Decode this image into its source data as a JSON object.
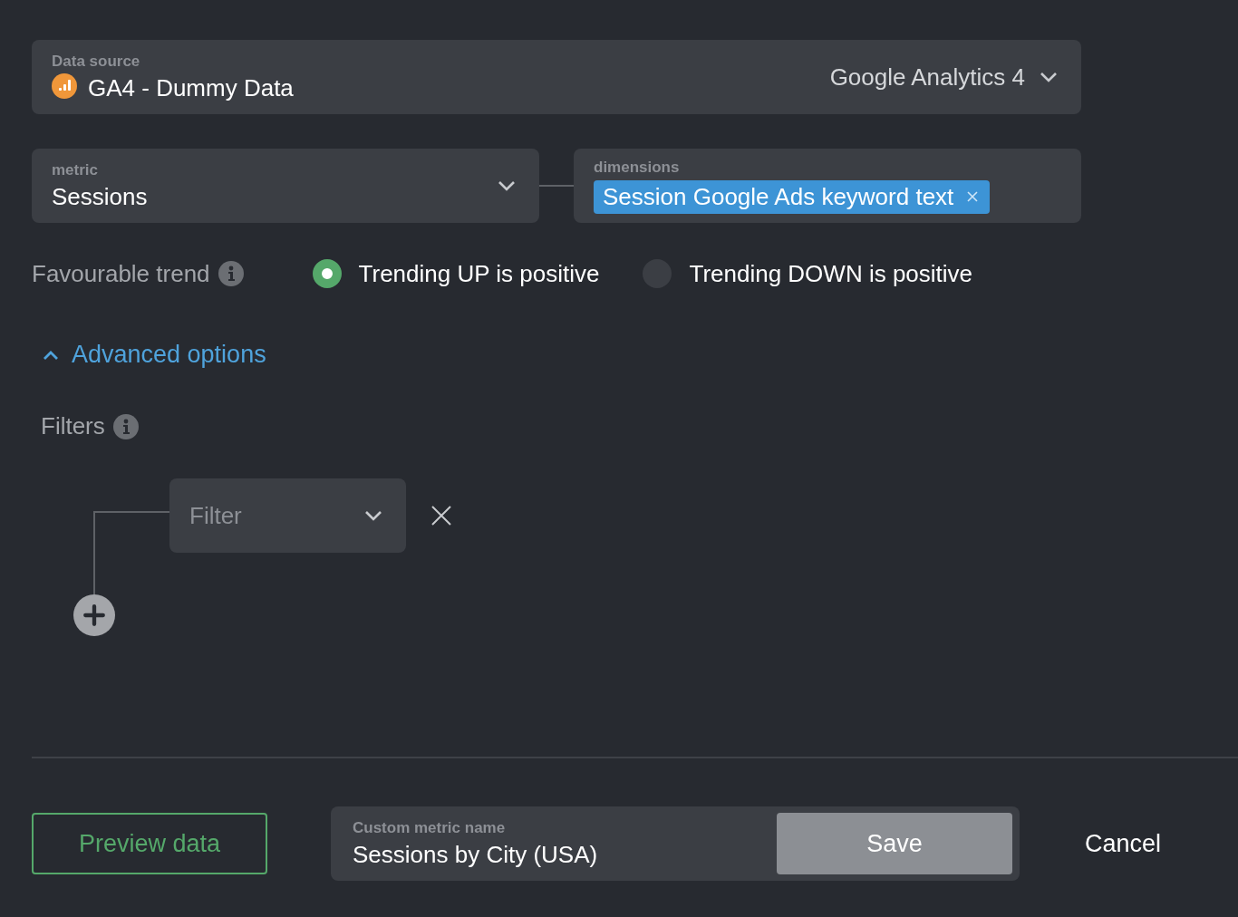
{
  "data_source": {
    "label": "Data source",
    "value": "GA4 - Dummy Data",
    "provider": "Google Analytics 4"
  },
  "metric": {
    "label": "metric",
    "value": "Sessions"
  },
  "dimensions": {
    "label": "dimensions",
    "chips": [
      "Session Google Ads keyword text"
    ]
  },
  "trend": {
    "label": "Favourable trend",
    "options": [
      {
        "label": "Trending UP is positive",
        "selected": true
      },
      {
        "label": "Trending DOWN is positive",
        "selected": false
      }
    ]
  },
  "advanced": {
    "label": "Advanced options",
    "expanded": true
  },
  "filters": {
    "label": "Filters",
    "rows": [
      {
        "placeholder": "Filter"
      }
    ]
  },
  "footer": {
    "preview": "Preview data",
    "custom_name": {
      "label": "Custom metric name",
      "value": "Sessions by City (USA)"
    },
    "save": "Save",
    "cancel": "Cancel"
  }
}
